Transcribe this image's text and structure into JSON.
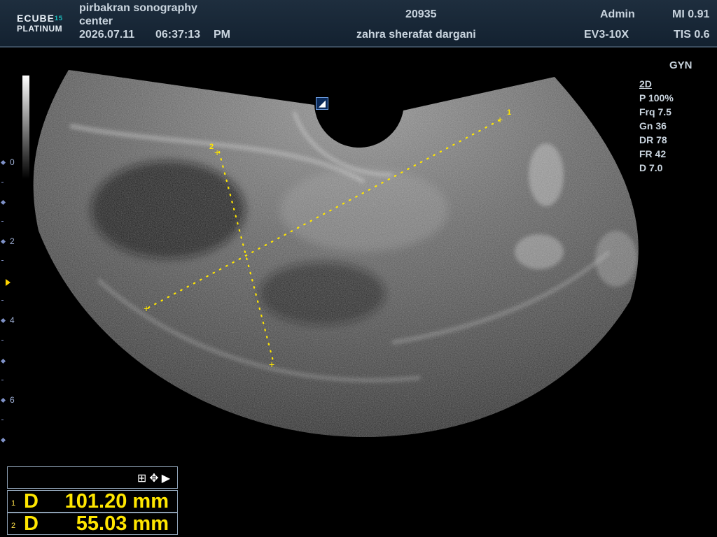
{
  "header": {
    "logo_line1": "ECUBE",
    "logo_sup": "15",
    "logo_line2": "PLATINUM",
    "institution_line1": "pirbakran sonography",
    "institution_line2": "center",
    "date": "2026.07.11",
    "time": "06:37:13",
    "ampm": "PM",
    "patient_id": "20935",
    "patient_name": "zahra sherafat dargani",
    "operator": "Admin",
    "probe": "EV3-10X",
    "mi": "MI 0.91",
    "tis": "TIS 0.6"
  },
  "preset": "GYN",
  "imaging_params": {
    "mode": "2D",
    "power": "P 100%",
    "frequency": "Frq 7.5",
    "gain": "Gn 36",
    "dynamic_range": "DR 78",
    "frame_rate": "FR 42",
    "depth": "D 7.0"
  },
  "depth_scale": {
    "labels": [
      "0",
      "2",
      "4",
      "6"
    ]
  },
  "orientation_marker": "◢",
  "calipers": [
    {
      "id": "1",
      "label": "1"
    },
    {
      "id": "2",
      "label": "2"
    }
  ],
  "measurements": {
    "toolbar_icons": [
      "grid-icon",
      "move-icon",
      "arrow-right-icon"
    ],
    "rows": [
      {
        "index": "1",
        "type": "D",
        "value": "101.20 mm"
      },
      {
        "index": "2",
        "type": "D",
        "value": "55.03 mm"
      }
    ]
  },
  "colors": {
    "caliper": "#ffe600",
    "header_bg": "#1a2a3a",
    "scale": "#7f92c8"
  }
}
